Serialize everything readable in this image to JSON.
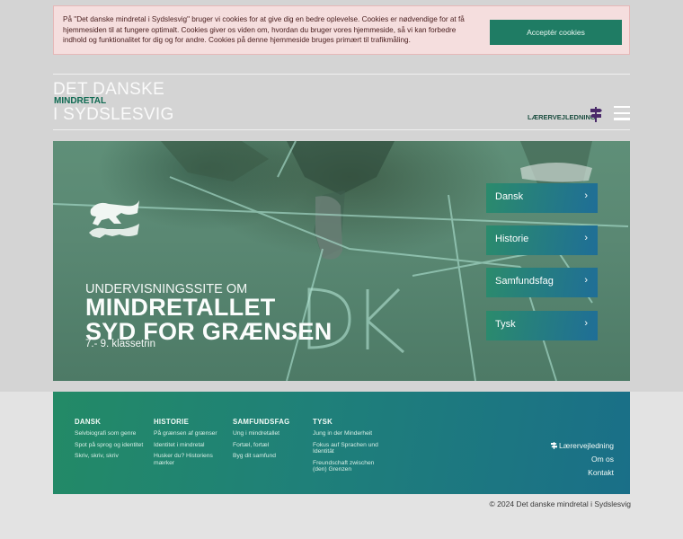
{
  "cookie": {
    "text": "På \"Det danske mindretal i Sydslesvig\" bruger vi cookies for at give dig en bedre oplevelse. Cookies er nødvendige for at få hjemmesiden til at fungere optimalt. Cookies giver os viden om, hvordan du bruger vores hjemmeside, så vi kan forbedre indhold og funktionalitet for dig og for andre. Cookies på denne hjemmeside bruges primært til trafikmåling.",
    "accept_label": "Acceptér cookies"
  },
  "logo": {
    "line1": "DET DANSKE",
    "line2": "MINDRETAL",
    "line3": "I SYDSLESVIG"
  },
  "header": {
    "teacher_guide": "LÆRERVEJLEDNING",
    "signpost_icon": "signpost-icon",
    "menu_icon": "hamburger-menu-icon"
  },
  "hero": {
    "subtitle": "UNDERVISNINGSSITE OM",
    "title_line1": "MINDRETALLET",
    "title_line2": "SYD FOR GRÆNSEN",
    "grade": "7.- 9. klassetrin",
    "chalk_text": "DK"
  },
  "subjects": [
    {
      "label": "Dansk",
      "chevron": "›"
    },
    {
      "label": "Historie",
      "chevron": "›"
    },
    {
      "label": "Samfundsfag",
      "chevron": "›"
    },
    {
      "label": "Tysk",
      "chevron": "›"
    }
  ],
  "footer": {
    "columns": [
      {
        "heading": "DANSK",
        "links": [
          "Selvbiografi som genre",
          "Spot på sprog og identitet",
          "Skriv, skriv, skriv"
        ]
      },
      {
        "heading": "HISTORIE",
        "links": [
          "På grænsen af grænser",
          "Identitet i mindretal",
          "Husker du? Historiens mærker"
        ]
      },
      {
        "heading": "SAMFUNDSFAG",
        "links": [
          "Ung i mindretallet",
          "Fortæl, fortæl",
          "Byg dit samfund"
        ]
      },
      {
        "heading": "TYSK",
        "links": [
          "Jung in der Minderheit",
          "Fokus auf Sprachen und Identität",
          "Freundschaft zwischen (den) Grenzen"
        ]
      }
    ],
    "right_links": [
      "Lærervejledning",
      "Om os",
      "Kontakt"
    ]
  },
  "copyright": "© 2024 Det danske mindretal i Sydslesvig",
  "colors": {
    "accent": "#1f7c64",
    "cookie_bg": "#f5dede",
    "brand_purple": "#4a2a6a"
  }
}
